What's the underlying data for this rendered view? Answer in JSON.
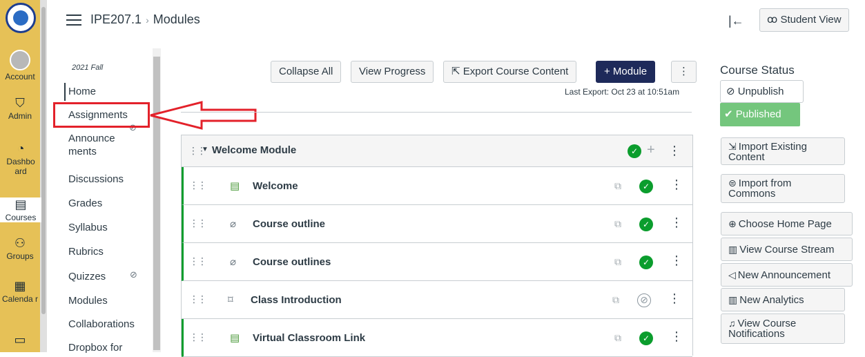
{
  "global_nav": {
    "items": [
      {
        "label": "Account",
        "icon": "avatar"
      },
      {
        "label": "Admin",
        "icon": "shield-icon"
      },
      {
        "label": "Dashbo ard",
        "icon": "dashboard-icon"
      },
      {
        "label": "Courses",
        "icon": "book-icon"
      },
      {
        "label": "Groups",
        "icon": "groups-icon"
      },
      {
        "label": "Calenda r",
        "icon": "calendar-icon"
      },
      {
        "label": "",
        "icon": "inbox-icon"
      }
    ],
    "color": "#e6c157"
  },
  "header": {
    "course_code": "IPE207.1",
    "separator": "›",
    "page": "Modules",
    "student_view": "Student View"
  },
  "course_nav": {
    "term": "2021 Fall",
    "items": [
      {
        "label": "Home"
      },
      {
        "label": "Assignments"
      },
      {
        "label": "Announce ments"
      },
      {
        "label": "Discussions"
      },
      {
        "label": "Grades"
      },
      {
        "label": "Syllabus"
      },
      {
        "label": "Rubrics"
      },
      {
        "label": "Quizzes"
      },
      {
        "label": "Modules"
      },
      {
        "label": "Collaborations"
      },
      {
        "label": "Dropbox for"
      }
    ]
  },
  "toolbar": {
    "collapse_all": "Collapse All",
    "view_progress": "View Progress",
    "export": "Export Course Content",
    "add_module": "+ Module",
    "last_export_label": "Last Export:",
    "last_export_value": "Oct 23 at 10:51am"
  },
  "module": {
    "title": "Welcome Module",
    "items": [
      {
        "title": "Welcome",
        "type": "page",
        "published": true
      },
      {
        "title": "Course outline",
        "type": "attachment",
        "published": true
      },
      {
        "title": "Course outlines",
        "type": "attachment",
        "published": true
      },
      {
        "title": "Class Introduction",
        "type": "discussion",
        "published": false
      },
      {
        "title": "Virtual Classroom Link",
        "type": "page",
        "published": true
      }
    ]
  },
  "sidebar": {
    "status_title": "Course Status",
    "unpublish": "Unpublish",
    "published": "Published",
    "buttons": [
      "Import Existing Content",
      "Import from Commons",
      "Choose Home Page",
      "View Course Stream",
      "New Announcement",
      "New Analytics",
      "View Course Notifications"
    ]
  },
  "colors": {
    "published_green": "#0b9d2d",
    "primary_button": "#1e2a5a",
    "highlight_red": "#e3212a"
  }
}
